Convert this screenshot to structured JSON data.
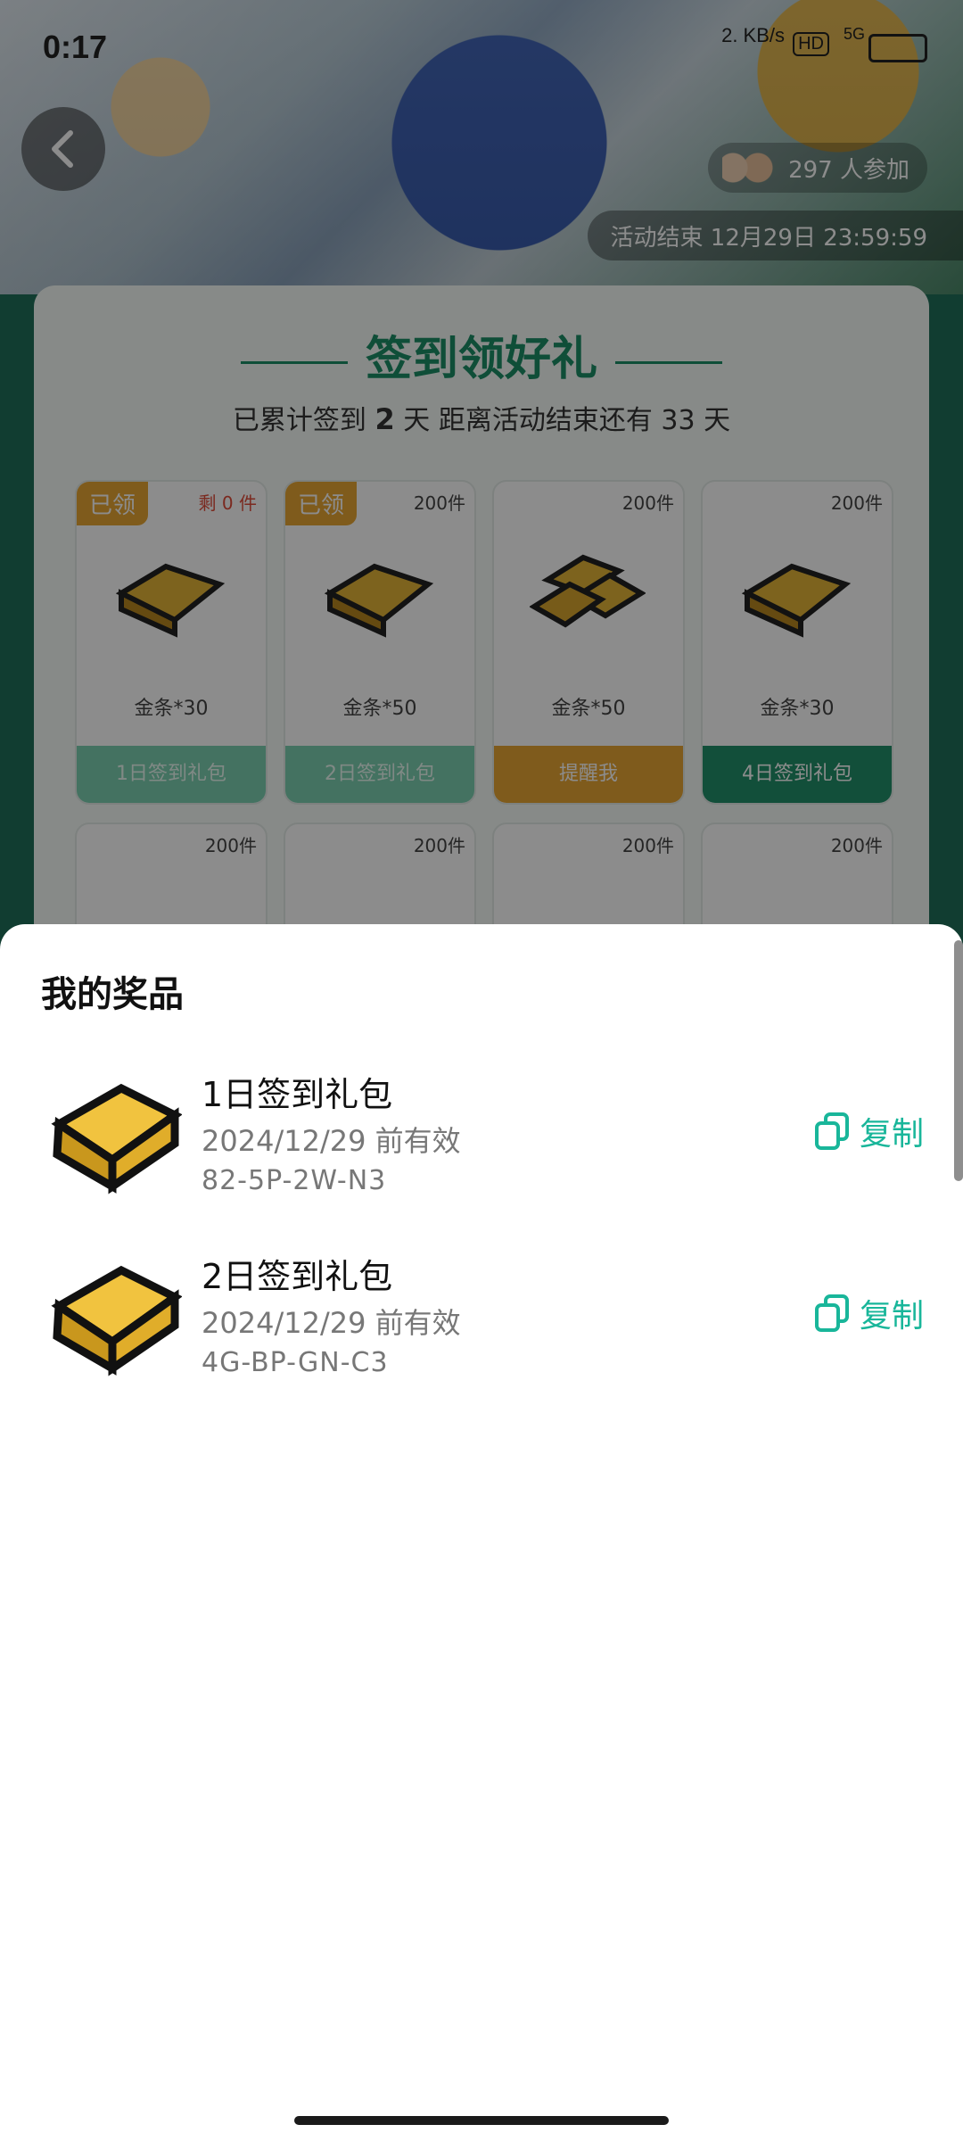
{
  "status_bar": {
    "time": "0:17",
    "network_speed": "2.\nKB/s",
    "hd_badge": "HD",
    "signal_label": "5G"
  },
  "header": {
    "participants_text": "297 人参加",
    "activity_end_text": "活动结束 12月29日 23:59:59"
  },
  "signin_card": {
    "title": "签到领好礼",
    "subtitle_prefix": "已累计签到",
    "signed_days": "2",
    "subtitle_mid": "天  距离活动结束还有 33 天",
    "days": [
      {
        "tag": "已领",
        "stock": "剩 0 件",
        "name": "金条*30",
        "button": "1日签到礼包",
        "state": "done"
      },
      {
        "tag": "已领",
        "stock": "200件",
        "name": "金条*50",
        "button": "2日签到礼包",
        "state": "done"
      },
      {
        "tag": "",
        "stock": "200件",
        "name": "金条*50",
        "button": "提醒我",
        "state": "remind"
      },
      {
        "tag": "",
        "stock": "200件",
        "name": "金条*30",
        "button": "4日签到礼包",
        "state": "normal"
      }
    ],
    "second_row_stock": [
      "200件",
      "200件",
      "200件",
      "200件"
    ]
  },
  "prizes_sheet": {
    "title": "我的奖品",
    "items": [
      {
        "name": "1日签到礼包",
        "valid": "2024/12/29 前有效",
        "code": "82-5P-2W-N3",
        "copy_label": "复制"
      },
      {
        "name": "2日签到礼包",
        "valid": "2024/12/29 前有效",
        "code": "4G-BP-GN-C3",
        "copy_label": "复制"
      }
    ]
  },
  "colors": {
    "accent": "#19b69a",
    "brand_green": "#1c8e67",
    "tag_orange": "#e8a634"
  },
  "icons": {
    "back": "chevron-left-icon",
    "copy": "copy-icon",
    "gold": "gold-bar-icon"
  }
}
